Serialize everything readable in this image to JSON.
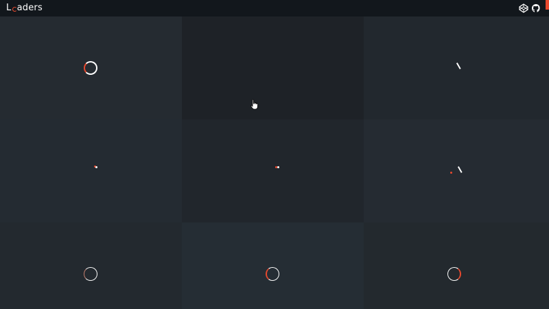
{
  "header": {
    "brand_prefix": "L",
    "brand_o": "o",
    "brand_suffix": "aders",
    "icons": [
      "codepen-icon",
      "github-icon"
    ]
  },
  "colors": {
    "accent": "#e8492e",
    "header_bg": "#12171c",
    "loader_main": "#ffffff"
  },
  "loaders": [
    {
      "name": "spinner-1",
      "style": "ring-red-left"
    },
    {
      "name": "spinner-2",
      "style": "ring-gap-left"
    },
    {
      "name": "spinner-3",
      "style": "dash"
    },
    {
      "name": "spinner-4",
      "style": "dots"
    },
    {
      "name": "spinner-5",
      "style": "dots"
    },
    {
      "name": "spinner-6",
      "style": "dash-dot"
    },
    {
      "name": "spinner-7",
      "style": "ring-thin"
    },
    {
      "name": "spinner-8",
      "style": "ring-red-left"
    },
    {
      "name": "spinner-9",
      "style": "ring-red-right"
    }
  ]
}
